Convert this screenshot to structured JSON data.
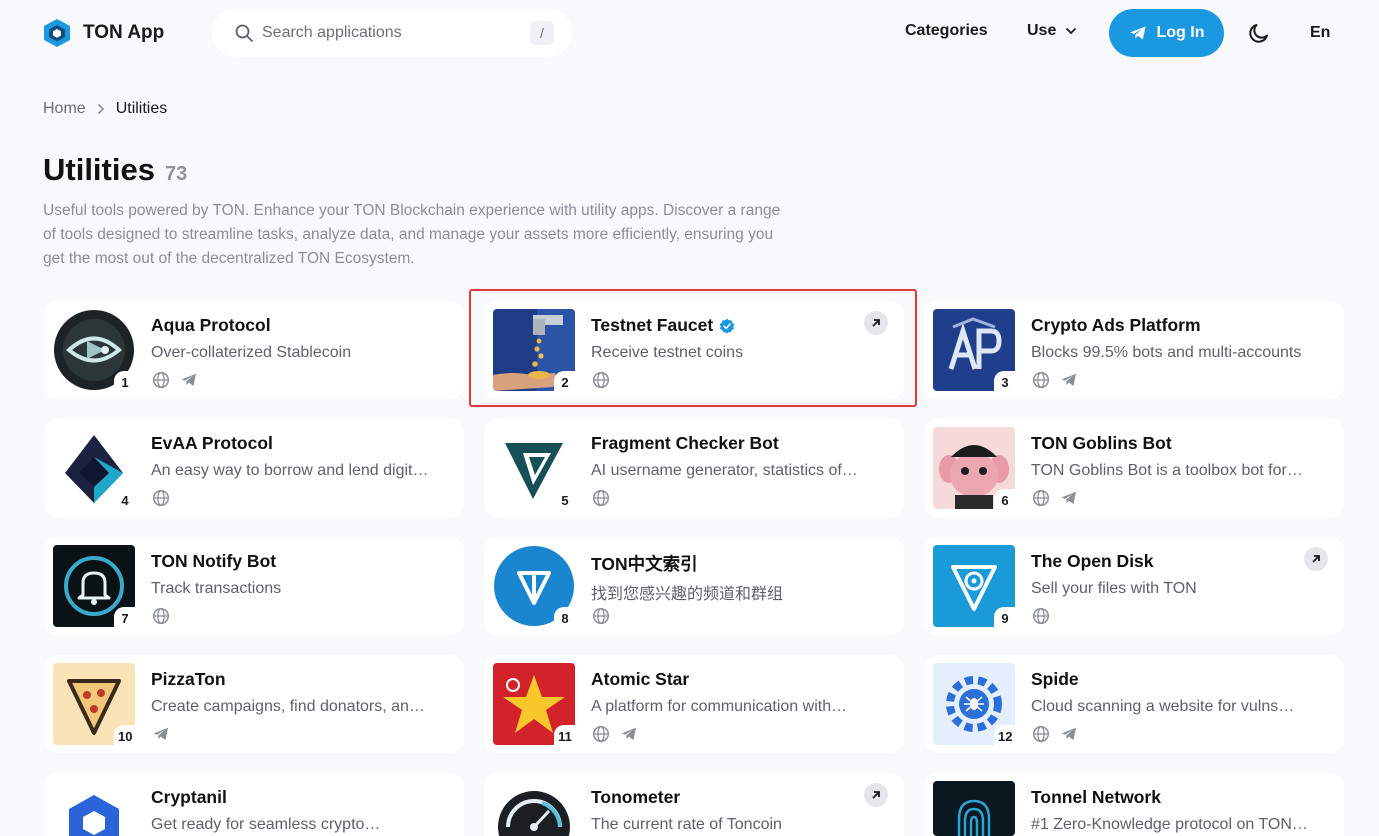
{
  "header": {
    "logo_text": "TON App",
    "search_placeholder": "Search applications",
    "search_shortcut": "/",
    "nav_categories": "Categories",
    "nav_use": "Use",
    "login_label": "Log In",
    "language": "En"
  },
  "breadcrumb": {
    "home": "Home",
    "current": "Utilities"
  },
  "page": {
    "title": "Utilities",
    "count": "73",
    "description": "Useful tools powered by TON. Enhance your TON Blockchain experience with utility apps. Discover a range of tools designed to streamline tasks, analyze data, and manage your assets more efficiently, ensuring you get the most out of the decentralized TON Ecosystem."
  },
  "colors": {
    "accent": "#1a98e0",
    "highlight": "#e03a3a"
  },
  "apps": [
    {
      "rank": "1",
      "name": "Aqua Protocol",
      "desc": "Over-collaterized Stablecoin",
      "links": [
        "globe-icon",
        "telegram-icon"
      ],
      "external": false,
      "verified": false
    },
    {
      "rank": "2",
      "name": "Testnet Faucet",
      "desc": "Receive testnet coins",
      "links": [
        "globe-icon"
      ],
      "external": true,
      "verified": true
    },
    {
      "rank": "3",
      "name": "Crypto Ads Platform",
      "desc": "Blocks 99.5% bots and multi-accounts",
      "links": [
        "globe-icon",
        "telegram-icon"
      ],
      "external": false,
      "verified": false
    },
    {
      "rank": "4",
      "name": "EvAA Protocol",
      "desc": "An easy way to borrow and lend digit…",
      "links": [
        "globe-icon"
      ],
      "external": false,
      "verified": false
    },
    {
      "rank": "5",
      "name": "Fragment Checker Bot",
      "desc": "AI username generator, statistics of…",
      "links": [
        "globe-icon"
      ],
      "external": false,
      "verified": false
    },
    {
      "rank": "6",
      "name": "TON Goblins Bot",
      "desc": "TON Goblins Bot is a toolbox bot for…",
      "links": [
        "globe-icon",
        "telegram-icon"
      ],
      "external": false,
      "verified": false
    },
    {
      "rank": "7",
      "name": "TON Notify Bot",
      "desc": "Track transactions",
      "links": [
        "globe-icon"
      ],
      "external": false,
      "verified": false
    },
    {
      "rank": "8",
      "name": "TON中文索引",
      "desc": "找到您感兴趣的频道和群组",
      "links": [
        "globe-icon"
      ],
      "external": false,
      "verified": false
    },
    {
      "rank": "9",
      "name": "The Open Disk",
      "desc": "Sell your files with TON",
      "links": [
        "globe-icon"
      ],
      "external": true,
      "verified": false
    },
    {
      "rank": "10",
      "name": "PizzaTon",
      "desc": "Create campaigns, find donators, an…",
      "links": [
        "telegram-icon"
      ],
      "external": false,
      "verified": false
    },
    {
      "rank": "11",
      "name": "Atomic Star",
      "desc": "A platform for communication with…",
      "links": [
        "globe-icon",
        "telegram-icon"
      ],
      "external": false,
      "verified": false
    },
    {
      "rank": "12",
      "name": "Spide",
      "desc": "Cloud scanning a website for vulns…",
      "links": [
        "globe-icon",
        "telegram-icon"
      ],
      "external": false,
      "verified": false
    },
    {
      "rank": "",
      "name": "Cryptanil",
      "desc": "Get ready for seamless crypto…",
      "links": [],
      "external": false,
      "verified": false
    },
    {
      "rank": "",
      "name": "Tonometer",
      "desc": "The current rate of Toncoin",
      "links": [],
      "external": true,
      "verified": false
    },
    {
      "rank": "",
      "name": "Tonnel Network",
      "desc": "#1 Zero-Knowledge protocol on TON…",
      "links": [],
      "external": false,
      "verified": false
    }
  ]
}
